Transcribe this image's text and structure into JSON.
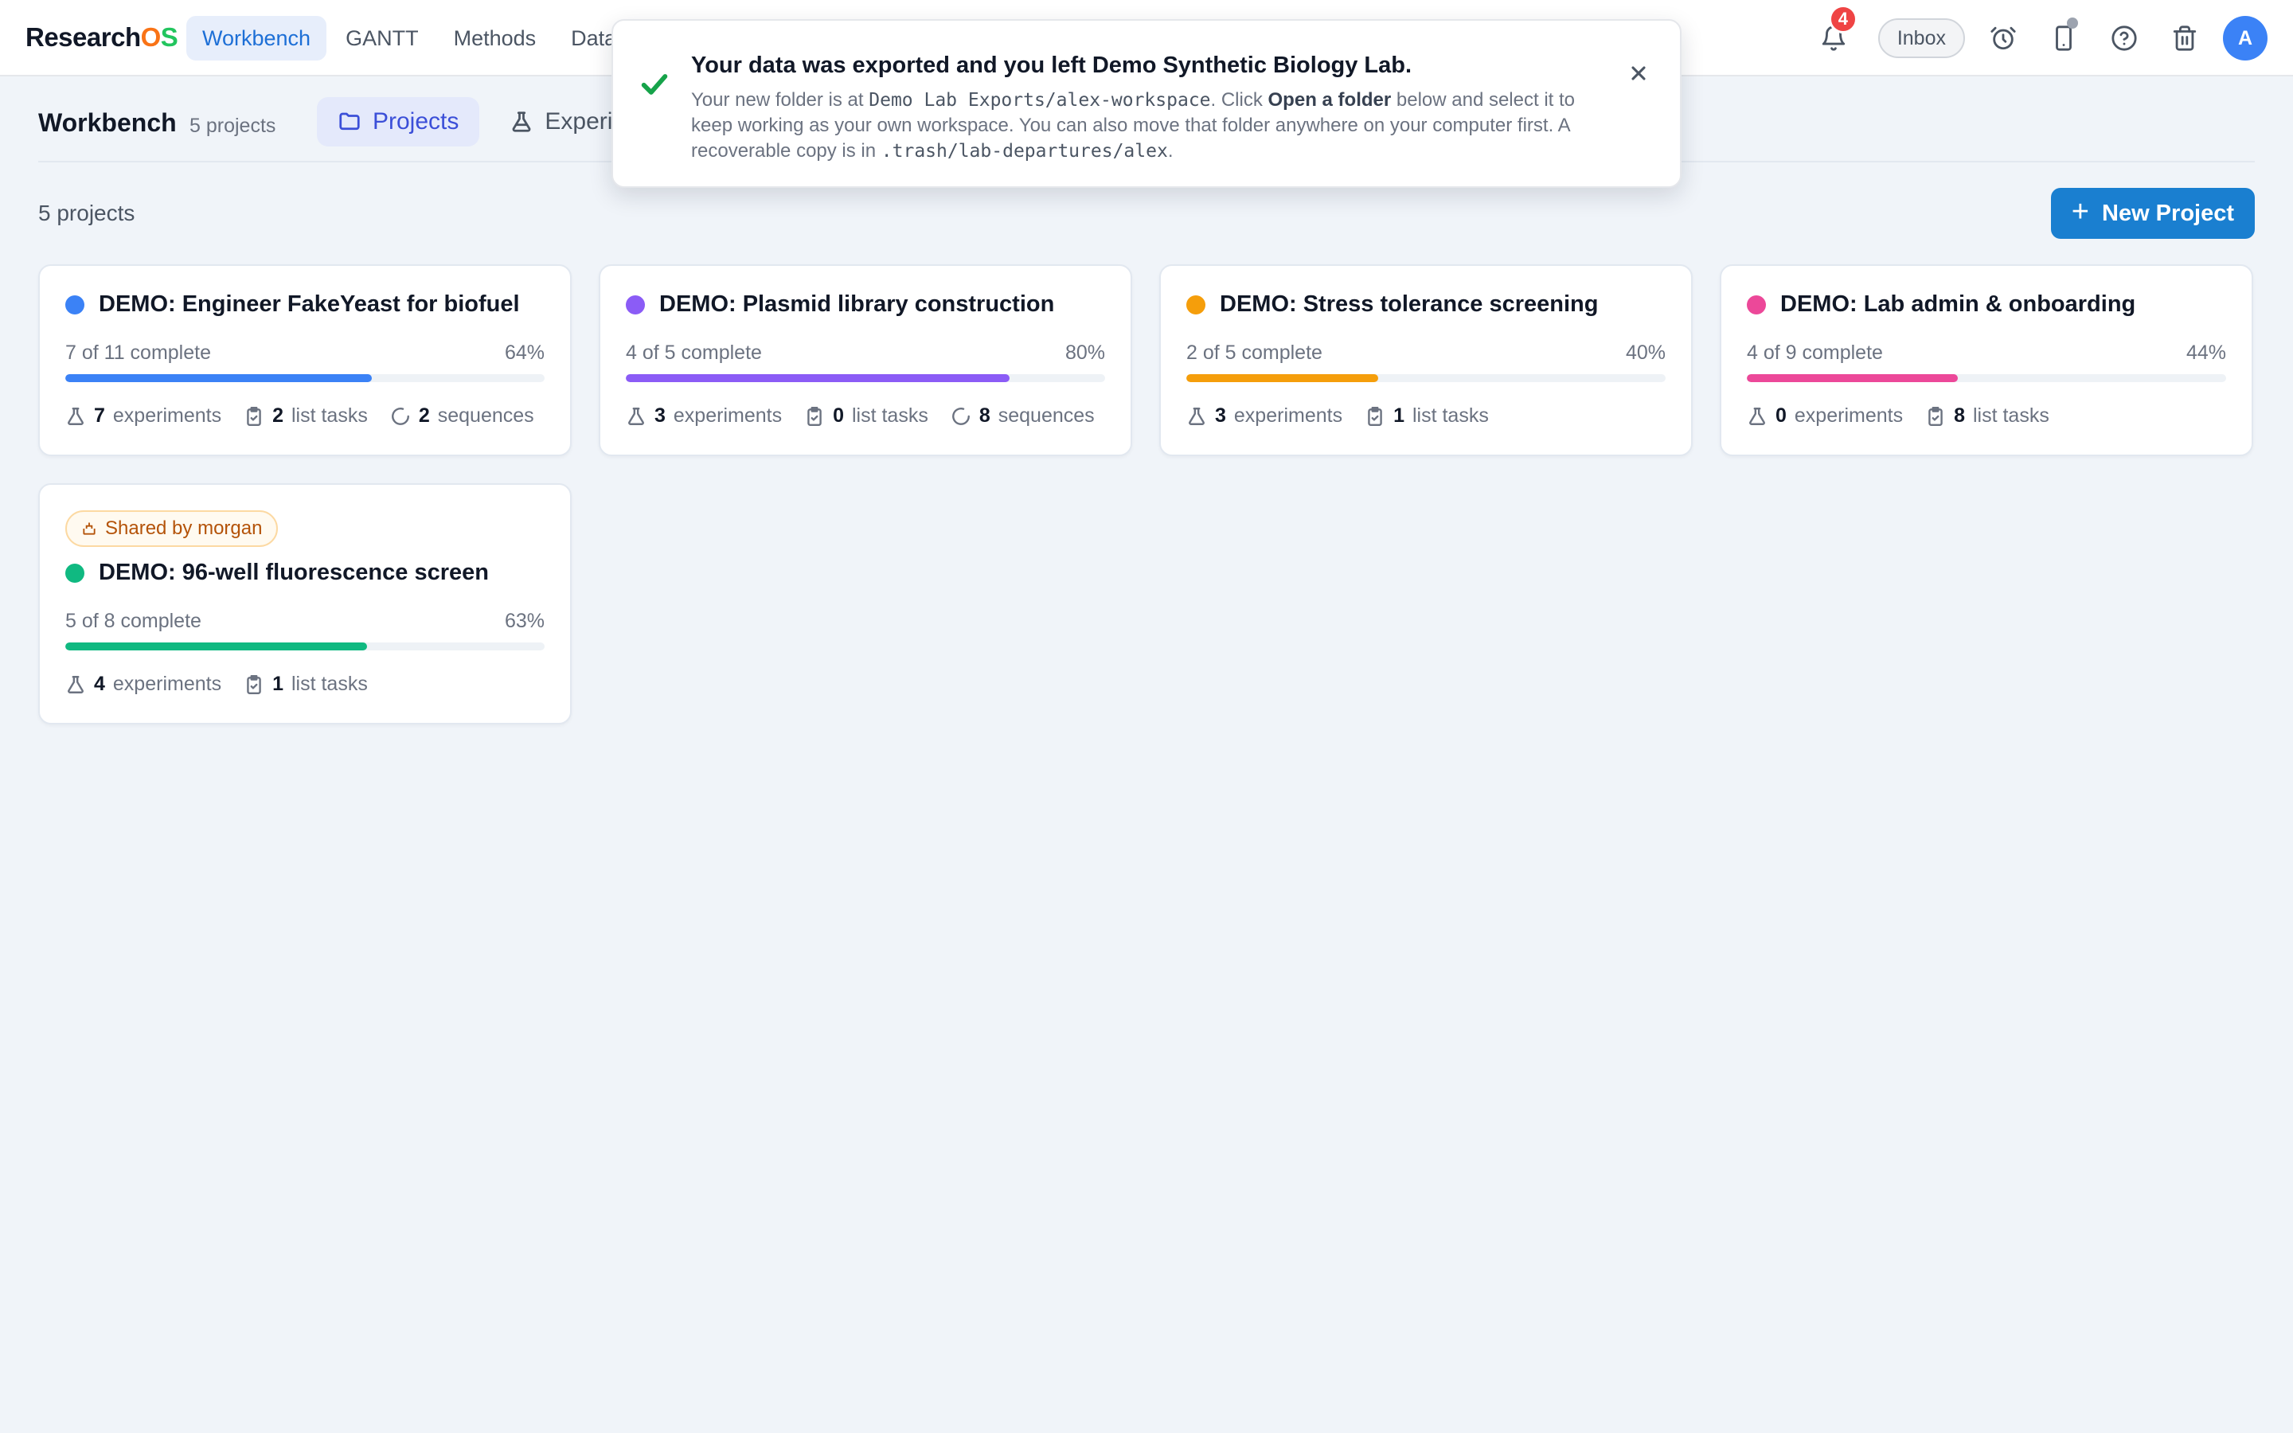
{
  "app": {
    "brand_prefix": "Research",
    "brand_o": "O",
    "brand_s": "S"
  },
  "nav": {
    "tabs": [
      {
        "label": "Workbench",
        "active": true
      },
      {
        "label": "GANTT",
        "active": false
      },
      {
        "label": "Methods",
        "active": false
      },
      {
        "label": "Data",
        "active": false
      }
    ]
  },
  "topbar": {
    "notification_count": "4",
    "inbox_label": "Inbox",
    "avatar_initial": "A"
  },
  "icons": [
    "bell-icon",
    "alarm-clock-icon",
    "phone-icon",
    "help-icon",
    "trash-icon",
    "check-icon",
    "close-icon",
    "folder-icon",
    "flask-icon",
    "clipboard-icon",
    "loop-icon",
    "plus-icon",
    "share-icon"
  ],
  "header": {
    "title": "Workbench",
    "count": "5 projects"
  },
  "subtabs": [
    {
      "label": "Projects",
      "active": true
    },
    {
      "label": "Experiments",
      "active": false
    }
  ],
  "main": {
    "count_label": "5 projects",
    "new_button": "New Project"
  },
  "stat_labels": {
    "experiments": "experiments",
    "list_tasks": "list tasks",
    "sequences": "sequences"
  },
  "projects": [
    {
      "title": "DEMO: Engineer FakeYeast for biofuel",
      "color": "#3b82f6",
      "progress_text": "7 of 11 complete",
      "percent": "64%",
      "progress": 0.64,
      "experiments": "7",
      "list_tasks": "2",
      "sequences": "2",
      "shared": null
    },
    {
      "title": "DEMO: Plasmid library construction",
      "color": "#8b5cf6",
      "progress_text": "4 of 5 complete",
      "percent": "80%",
      "progress": 0.8,
      "experiments": "3",
      "list_tasks": "0",
      "sequences": "8",
      "shared": null
    },
    {
      "title": "DEMO: Stress tolerance screening",
      "color": "#f59e0b",
      "progress_text": "2 of 5 complete",
      "percent": "40%",
      "progress": 0.4,
      "experiments": "3",
      "list_tasks": "1",
      "sequences": null,
      "shared": null
    },
    {
      "title": "DEMO: Lab admin & onboarding",
      "color": "#ec4899",
      "progress_text": "4 of 9 complete",
      "percent": "44%",
      "progress": 0.44,
      "experiments": "0",
      "list_tasks": "8",
      "sequences": null,
      "shared": null
    },
    {
      "title": "DEMO: 96-well fluorescence screen",
      "color": "#10b981",
      "progress_text": "5 of 8 complete",
      "percent": "63%",
      "progress": 0.63,
      "experiments": "4",
      "list_tasks": "1",
      "sequences": null,
      "shared": "Shared by morgan"
    }
  ],
  "toast": {
    "title": "Your data was exported and you left Demo Synthetic Biology Lab.",
    "body_1": "Your new folder is at ",
    "path_1": "Demo Lab Exports/alex-workspace",
    "body_2": ". Click ",
    "action": "Open a folder",
    "body_3": " below and select it to keep working as your own workspace. You can also move that folder anywhere on your computer first. A recoverable copy is in ",
    "path_2": ".trash/lab-departures/alex",
    "body_4": "."
  }
}
